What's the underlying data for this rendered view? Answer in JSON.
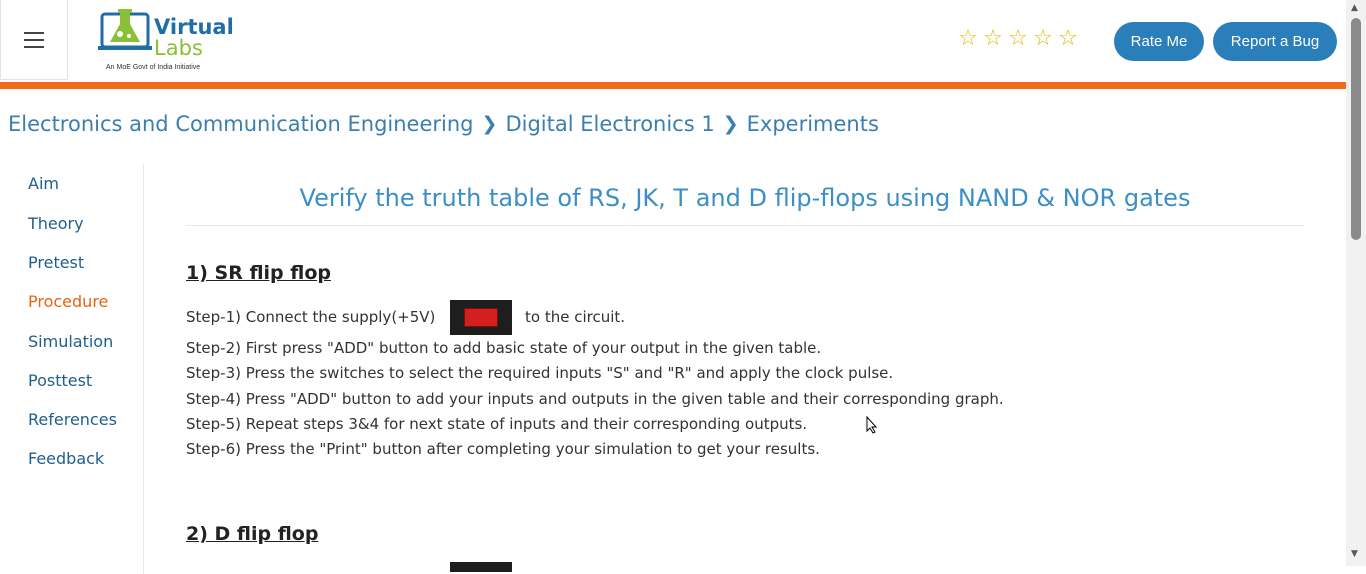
{
  "header": {
    "logo": {
      "line1": "Virtual",
      "line2": "Labs",
      "tagline": "An MoE Govt of India Initiative"
    },
    "rating_stars": 5,
    "rate_button": "Rate Me",
    "bug_button": "Report a Bug",
    "accent_color": "#f26b1d",
    "button_color": "#2a7fba"
  },
  "breadcrumb": {
    "items": [
      "Electronics and Communication Engineering",
      "Digital Electronics 1",
      "Experiments"
    ]
  },
  "sidebar": {
    "items": [
      {
        "label": "Aim",
        "active": false
      },
      {
        "label": "Theory",
        "active": false
      },
      {
        "label": "Pretest",
        "active": false
      },
      {
        "label": "Procedure",
        "active": true
      },
      {
        "label": "Simulation",
        "active": false
      },
      {
        "label": "Posttest",
        "active": false
      },
      {
        "label": "References",
        "active": false
      },
      {
        "label": "Feedback",
        "active": false
      }
    ]
  },
  "main": {
    "title": "Verify the truth table of RS, JK, T and D flip-flops using NAND & NOR gates",
    "sections": [
      {
        "heading": "1) SR flip flop",
        "steps": [
          "Step-1) Connect the supply(+5V)",
          "Step-2) First press \"ADD\" button to add basic state of your output in the given table.",
          "Step-3) Press the switches to select the required inputs \"S\" and \"R\" and apply the clock pulse.",
          "Step-4) Press \"ADD\" button to add your inputs and outputs in the given table and their corresponding graph.",
          "Step-5) Repeat steps 3&4 for next state of inputs and their corresponding outputs.",
          "Step-6) Press the \"Print\" button after completing your simulation to get your results."
        ],
        "step1_tail": "to the circuit."
      },
      {
        "heading": "2) D flip flop"
      }
    ]
  }
}
